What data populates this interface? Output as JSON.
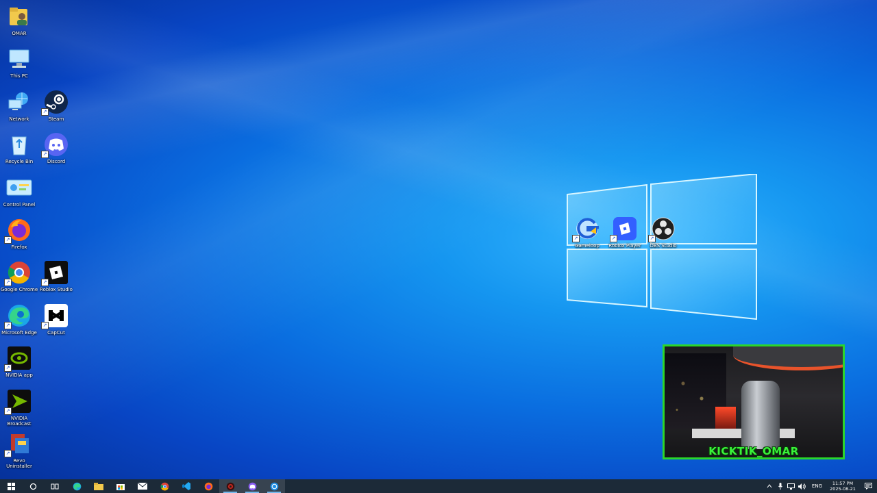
{
  "desktop": {
    "icons": [
      {
        "label": "OMAR",
        "icon": "user-folder-icon",
        "shortcut": false
      },
      {
        "label": "This PC",
        "icon": "computer-icon",
        "shortcut": false
      },
      {
        "label": "Network",
        "icon": "network-icon",
        "shortcut": false
      },
      {
        "label": "Steam",
        "icon": "steam-icon",
        "shortcut": true
      },
      {
        "label": "Recycle Bin",
        "icon": "recycle-bin-icon",
        "shortcut": false
      },
      {
        "label": "Discord",
        "icon": "discord-icon",
        "shortcut": true
      },
      {
        "label": "Control Panel",
        "icon": "control-panel-icon",
        "shortcut": false
      },
      {
        "label": "Firefox",
        "icon": "firefox-icon",
        "shortcut": true
      },
      {
        "label": "Google Chrome",
        "icon": "chrome-icon",
        "shortcut": true
      },
      {
        "label": "Roblox Studio",
        "icon": "roblox-studio-icon",
        "shortcut": true
      },
      {
        "label": "Microsoft Edge",
        "icon": "edge-icon",
        "shortcut": true
      },
      {
        "label": "CapCut",
        "icon": "capcut-icon",
        "shortcut": true
      },
      {
        "label": "NVIDIA app",
        "icon": "nvidia-icon",
        "shortcut": true
      },
      {
        "label": "NVIDIA Broadcast",
        "icon": "nvidia-broadcast-icon",
        "shortcut": true
      },
      {
        "label": "Revo Uninstaller",
        "icon": "revo-uninstaller-icon",
        "shortcut": true
      },
      {
        "label": "Gameloop",
        "icon": "gameloop-icon",
        "shortcut": true
      },
      {
        "label": "Roblox Player",
        "icon": "roblox-player-icon",
        "shortcut": true
      },
      {
        "label": "OBS Studio",
        "icon": "obs-icon",
        "shortcut": true
      }
    ]
  },
  "webcam": {
    "name_main": "KICKTIK_OMAR",
    "border_color": "#2bd62b",
    "name_color": "#3af23a"
  },
  "taskbar": {
    "apps": [
      {
        "name": "start-button",
        "active": false
      },
      {
        "name": "search-button",
        "active": false
      },
      {
        "name": "task-view-button",
        "active": false
      },
      {
        "name": "edge-taskbar-button",
        "active": false
      },
      {
        "name": "file-explorer-taskbar-button",
        "active": false
      },
      {
        "name": "microsoft-store-taskbar-button",
        "active": false
      },
      {
        "name": "mail-taskbar-button",
        "active": false
      },
      {
        "name": "chrome-taskbar-button",
        "active": false
      },
      {
        "name": "vscode-taskbar-button",
        "active": false
      },
      {
        "name": "firefox-taskbar-button",
        "active": false
      },
      {
        "name": "obs-taskbar-button",
        "active": true
      },
      {
        "name": "discord-taskbar-button",
        "active": true
      },
      {
        "name": "gameloop-taskbar-button",
        "active": true
      }
    ],
    "tray": {
      "language": "ENG",
      "time": "11:57 PM",
      "date": "2025-08-21"
    }
  },
  "colors": {
    "taskbar_bg": "#1c2a38",
    "accent": "#76b9ed"
  }
}
